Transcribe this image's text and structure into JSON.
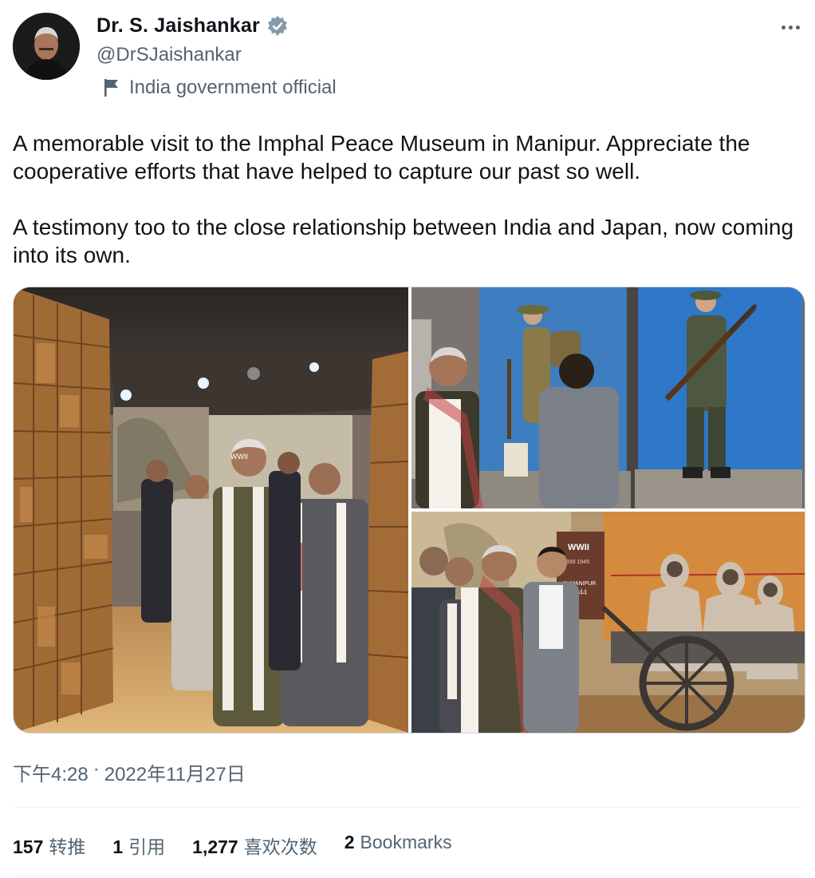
{
  "author": {
    "display_name": "Dr. S. Jaishankar",
    "handle": "@DrSJaishankar",
    "affiliation": "India government official",
    "verified_icon": "verified-badge-icon",
    "affiliation_icon": "flag-icon"
  },
  "tweet": {
    "paragraphs": [
      "A memorable visit to the Imphal Peace Museum in Manipur. Appreciate the cooperative efforts that have helped to capture our past so well.",
      "A testimony too to the close relationship between India and Japan, now coming into its own."
    ],
    "time": "下午4:28",
    "separator": "·",
    "date": "2022年11月27日"
  },
  "media": {
    "photos": [
      {
        "alt": "museum corridor visit"
      },
      {
        "alt": "soldier mannequins display"
      },
      {
        "alt": "WWII exhibit with cart"
      }
    ],
    "exhibit_texts": {
      "wwii_panel": "WWII",
      "years": "1939 1945",
      "manipur": "IN MANIPUR",
      "year_1944": "1944"
    }
  },
  "stats": {
    "retweets_count": "157",
    "retweets_label": "转推",
    "quotes_count": "1",
    "quotes_label": "引用",
    "likes_count": "1,277",
    "likes_label": "喜欢次数",
    "bookmarks_count": "2",
    "bookmarks_label": "Bookmarks"
  },
  "colors": {
    "text_primary": "#0f1419",
    "text_secondary": "#536471",
    "verified": "#829aab",
    "divider": "#eff3f4"
  }
}
